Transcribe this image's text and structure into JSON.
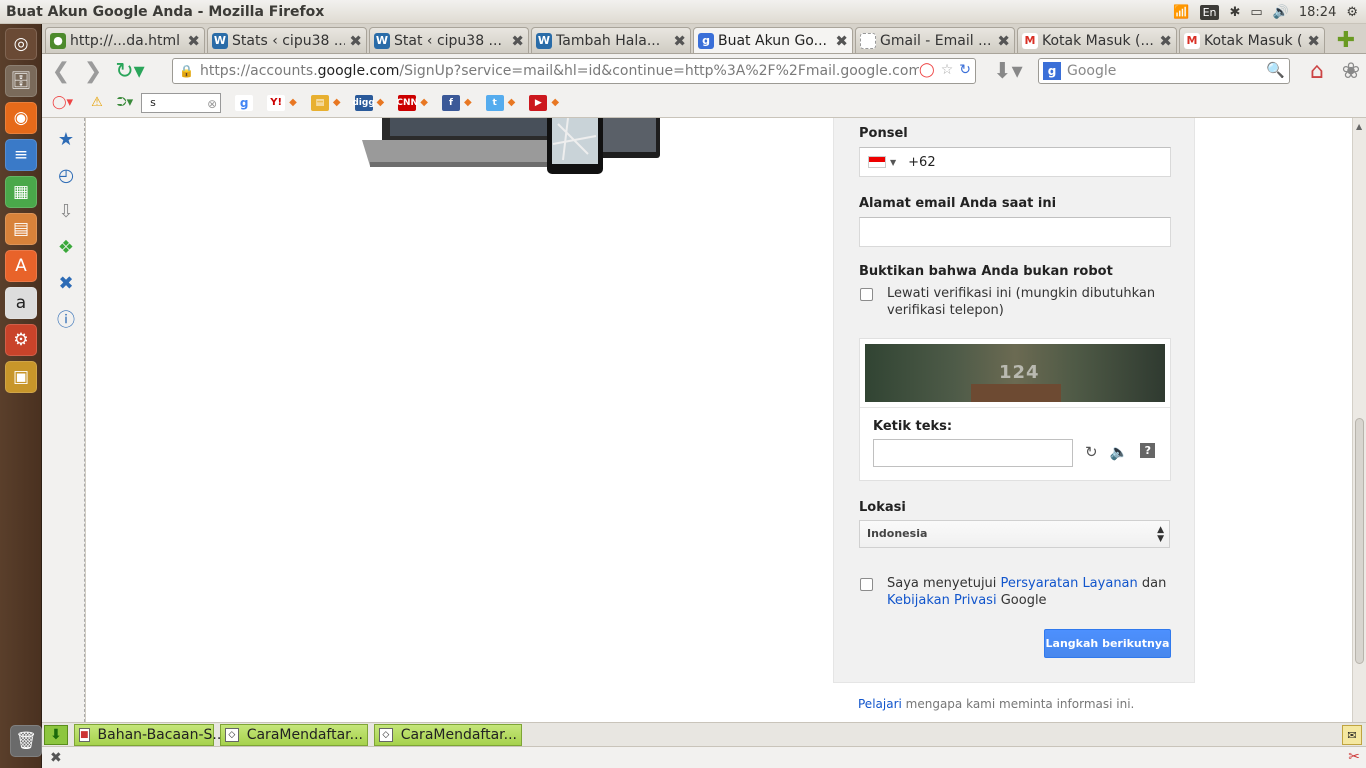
{
  "window": {
    "title": "Buat Akun Google Anda - Mozilla Firefox",
    "tray": {
      "lang": "En",
      "clock": "18:24"
    }
  },
  "tabs": [
    {
      "label": "http://...da.html",
      "favicon": "globe-icon",
      "color": "#4d8a2c",
      "active": false
    },
    {
      "label": "Stats ‹ cipu38 ...",
      "favicon": "wordpress-icon",
      "color": "#2a6ca8",
      "active": false
    },
    {
      "label": "Stat ‹ cipu38 ...",
      "favicon": "wordpress-icon",
      "color": "#2a6ca8",
      "active": false
    },
    {
      "label": "Tambah Hala...",
      "favicon": "wordpress-icon",
      "color": "#2a6ca8",
      "active": false
    },
    {
      "label": "Buat Akun Go...",
      "favicon": "google-icon",
      "color": "#3a6fd8",
      "active": true
    },
    {
      "label": "Gmail - Email ...",
      "favicon": "blank-page-icon",
      "color": "#bbbbbb",
      "active": false
    },
    {
      "label": "Kotak Masuk (...",
      "favicon": "gmail-icon",
      "color": "#d93025",
      "active": false
    },
    {
      "label": "Kotak Masuk (...",
      "favicon": "gmail-icon",
      "color": "#d93025",
      "active": false
    }
  ],
  "navbar": {
    "url_prefix": "https://accounts.",
    "url_host": "google.com",
    "url_rest": "/SignUp?service=mail&hl=id&continue=http%3A%2F%2Fmail.google.com%",
    "search_placeholder": "Google"
  },
  "toolbar": {
    "search_value": "s"
  },
  "form": {
    "phone_label": "Ponsel",
    "phone_prefix": "+62",
    "email_label": "Alamat email Anda saat ini",
    "robot_label": "Buktikan bahwa Anda bukan robot",
    "skip_verify_line1": "Lewati verifikasi ini (mungkin dibutuhkan",
    "skip_verify_line2": "verifikasi telepon)",
    "captcha_number": "124",
    "captcha_label": "Ketik teks:",
    "location_label": "Lokasi",
    "location_value": "Indonesia",
    "agree_prefix": "Saya menyetujui ",
    "agree_terms": "Persyaratan Layanan",
    "agree_and": " dan",
    "agree_privacy": "Kebijakan Privasi",
    "agree_suffix": " Google",
    "next_button": "Langkah berikutnya",
    "learn_link": "Pelajari",
    "learn_text": " mengapa kami meminta informasi ini."
  },
  "downloads": [
    {
      "label": "Bahan-Bacaan-S..."
    },
    {
      "label": "CaraMendaftar..."
    },
    {
      "label": "CaraMendaftar..."
    }
  ],
  "colors": {
    "accent_blue": "#4d90fe",
    "link": "#1155cc",
    "panel_bg": "#f1f1f1"
  }
}
